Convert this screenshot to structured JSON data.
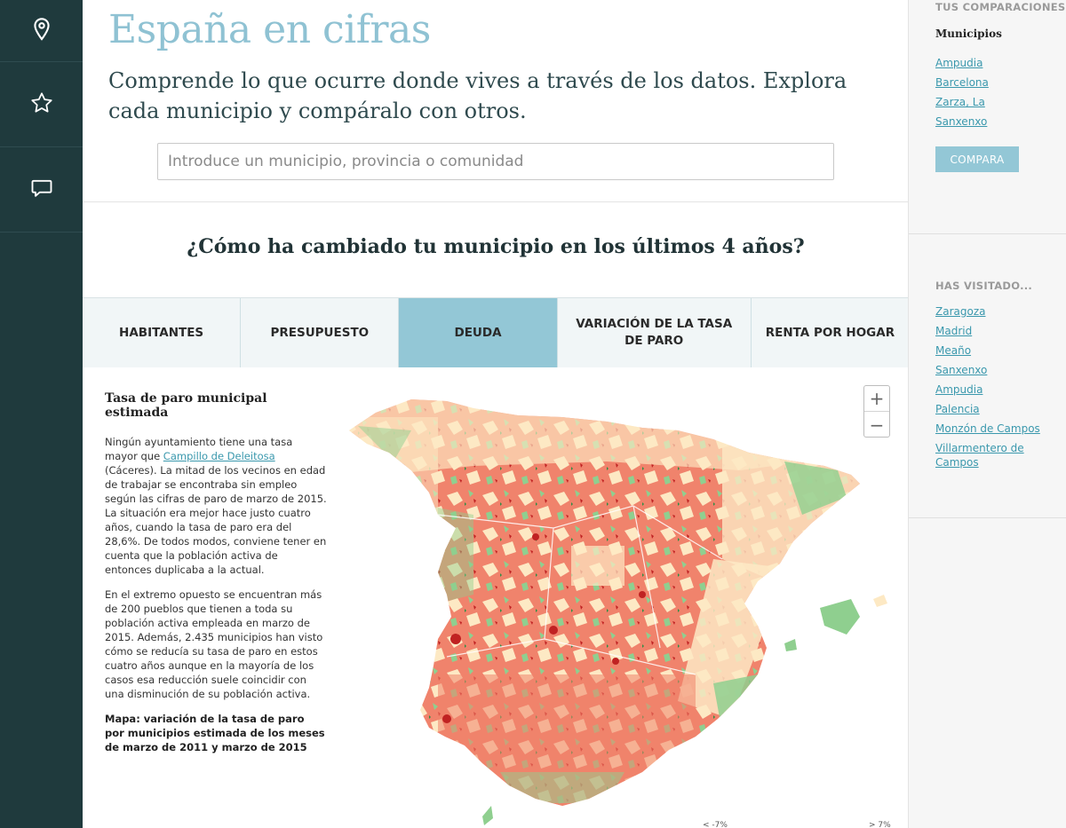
{
  "nav": {
    "icons": [
      "map-pin-icon",
      "star-icon",
      "chat-icon"
    ]
  },
  "header": {
    "title": "España en cifras",
    "subtitle": "Comprende lo que ocurre donde vives a través de los datos. Explora cada municipio y compáralo con otros.",
    "search_placeholder": "Introduce un municipio, provincia o comunidad"
  },
  "section": {
    "question": "¿Cómo ha cambiado tu municipio en los últimos 4 años?"
  },
  "tabs": [
    {
      "label": "HABITANTES",
      "active": false
    },
    {
      "label": "PRESUPUESTO",
      "active": false
    },
    {
      "label": "DEUDA",
      "active": true
    },
    {
      "label": "VARIACIÓN DE LA TASA DE PARO",
      "active": false
    },
    {
      "label": "RENTA POR HOGAR",
      "active": false
    }
  ],
  "article": {
    "heading": "Tasa de paro municipal estimada",
    "p1_before": "Ningún ayuntamiento tiene una tasa mayor que ",
    "p1_link": "Campillo de Deleitosa",
    "p1_after": " (Cáceres). La mitad de los vecinos en edad de trabajar se encontraba sin empleo según las cifras de paro de marzo de 2015. La situación era mejor hace justo cuatro años, cuando la tasa de paro era del 28,6%. De todos modos, conviene tener en cuenta que la población activa de entonces duplicaba a la actual.",
    "p2": "En el extremo opuesto se encuentran más de 200 pueblos que tienen a toda su población activa empleada en marzo de 2015. Además, 2.435 municipios han visto cómo se reducía su tasa de paro en estos cuatro años aunque en la mayoría de los casos esa reducción suele coincidir con una disminución de su población activa.",
    "caption": "Mapa: variación de la tasa de paro por municipios estimada de los meses de marzo de 2011 y marzo de 2015"
  },
  "map": {
    "zoom_in": "+",
    "zoom_out": "−",
    "legend_low": "< -7%",
    "legend_high": "> 7%",
    "colors": {
      "cream": "#fde9c4",
      "salmon": "#f0836c",
      "green": "#8fcf8f",
      "dark_red": "#c02222",
      "dark_green": "#2f8f45"
    }
  },
  "sidebar": {
    "comparisons_label": "TUS COMPARACIONES",
    "municipios_label": "Municipios",
    "comparisons": [
      "Ampudia",
      "Barcelona",
      "Zarza, La",
      "Sanxenxo"
    ],
    "compare_button": "COMPARA",
    "visited_label": "HAS VISITADO...",
    "visited": [
      "Zaragoza",
      "Madrid",
      "Meaño",
      "Sanxenxo",
      "Ampudia",
      "Palencia",
      "Monzón de Campos",
      "Villarmentero de Campos"
    ]
  }
}
